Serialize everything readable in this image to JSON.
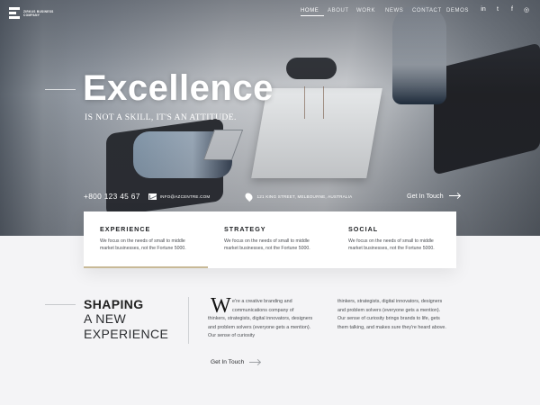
{
  "logo": {
    "text": "ZIRKUS BUSINESS COMPANY"
  },
  "nav": {
    "home": "HOME",
    "about": "ABOUT",
    "work": "WORK",
    "news": "NEWS",
    "contact": "CONTACT",
    "demos": "DEMOS"
  },
  "social": {
    "linkedin": "in",
    "twitter": "t",
    "facebook": "f",
    "instagram": "◎"
  },
  "hero": {
    "title": "Excellence",
    "subtitle": "IS NOT A SKILL, IT'S AN ATTITUDE.",
    "phone": "+800 123 45 67",
    "email": "INFO@AZCENTRE.COM",
    "address": "121 KING STREET, MELBOURNE, AUSTRALIA",
    "cta": "Get In Touch"
  },
  "cards": [
    {
      "title": "EXPERIENCE",
      "text": "We focus on the needs of small to middle market businesses, not the Fortune 5000."
    },
    {
      "title": "STRATEGY",
      "text": "We focus on the needs of small to middle market businesses, not the Fortune 5000."
    },
    {
      "title": "SOCIAL",
      "text": "We focus on the needs of small to middle market businesses, not the Fortune 5000."
    }
  ],
  "shaping": {
    "line1": "SHAPING",
    "line2": "A NEW",
    "line3": "EXPERIENCE",
    "dropcap": "W",
    "para1": "e're a creative branding and communications company of",
    "para1b": "thinkers, strategists, digital innovators, designers and problem solvers (everyone gets a mention). Our sense of curiosity",
    "para2": "thinkers, strategists, digital innovators, designers and problem solvers (everyone gets a mention). Our sense of curiosity brings brands to life, gets them talking, and makes sure they're heard above.",
    "cta": "Get In Touch"
  },
  "colors": {
    "accent": "#c8b996",
    "dark": "#1f2124",
    "background": "#f4f4f6"
  }
}
